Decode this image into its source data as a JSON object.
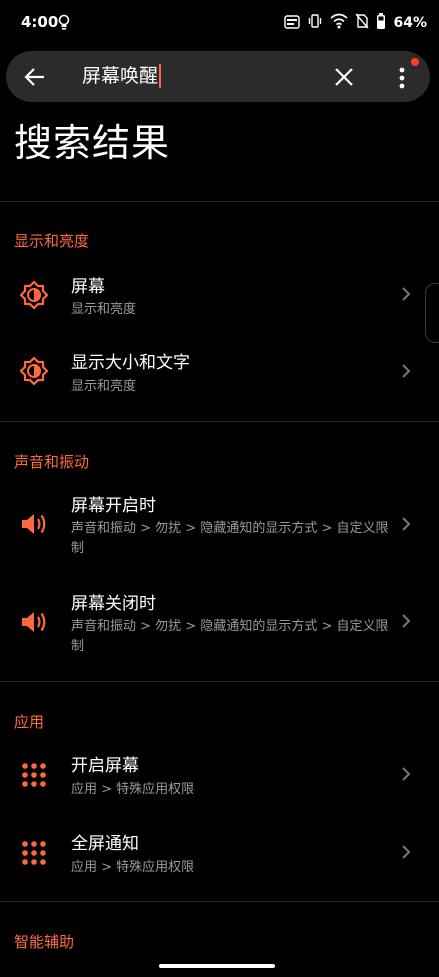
{
  "status_bar": {
    "time": "4:00",
    "battery": "64%",
    "icons": [
      "lightbulb-icon",
      "auto-hd-icon",
      "vibrate-icon",
      "wifi-icon",
      "no-sim-icon",
      "battery-icon"
    ]
  },
  "search": {
    "query": "屏幕唤醒"
  },
  "page_title": "搜索结果",
  "sections": [
    {
      "title": "显示和亮度",
      "items": [
        {
          "title": "屏幕",
          "subtitle": "显示和亮度",
          "icon": "brightness-icon"
        },
        {
          "title": "显示大小和文字",
          "subtitle": "显示和亮度",
          "icon": "brightness-icon"
        }
      ]
    },
    {
      "title": "声音和振动",
      "items": [
        {
          "title": "屏幕开启时",
          "subtitle": "声音和振动 > 勿扰 > 隐藏通知的显示方式 > 自定义限制",
          "icon": "speaker-icon"
        },
        {
          "title": "屏幕关闭时",
          "subtitle": "声音和振动 > 勿扰 > 隐藏通知的显示方式 > 自定义限制",
          "icon": "speaker-icon"
        }
      ]
    },
    {
      "title": "应用",
      "items": [
        {
          "title": "开启屏幕",
          "subtitle": "应用 > 特殊应用权限",
          "icon": "apps-grid-icon"
        },
        {
          "title": "全屏通知",
          "subtitle": "应用 > 特殊应用权限",
          "icon": "apps-grid-icon"
        }
      ]
    },
    {
      "title": "智能辅助",
      "items": []
    }
  ],
  "colors": {
    "accent": "#ff6a3d",
    "background": "#000000",
    "search_bar": "#2b2b2b",
    "subtitle": "#9a9a9a"
  }
}
